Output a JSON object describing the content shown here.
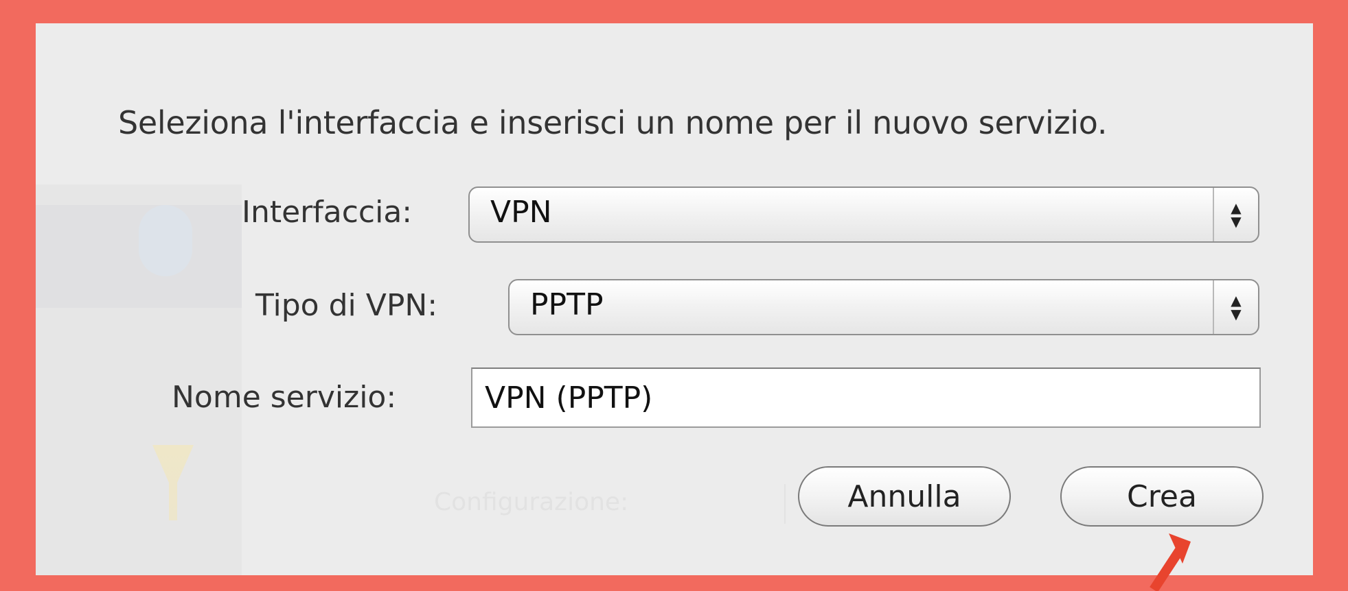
{
  "dialog": {
    "prompt": "Seleziona l'interfaccia e inserisci un nome per il nuovo servizio.",
    "interface": {
      "label": "Interfaccia:",
      "value": "VPN"
    },
    "vpn_type": {
      "label": "Tipo di VPN:",
      "value": "PPTP"
    },
    "service_name": {
      "label": "Nome servizio:",
      "value": "VPN (PPTP)"
    },
    "buttons": {
      "cancel": "Annulla",
      "create": "Crea"
    }
  },
  "background": {
    "label": "Configurazione:"
  },
  "colors": {
    "frame": "#f26a5e",
    "sheet": "#ececec",
    "annotation_arrow": "#e8442e"
  },
  "icons": {
    "stepper": "up-down-arrows-icon",
    "annotation": "red-arrow-pointer-icon"
  }
}
